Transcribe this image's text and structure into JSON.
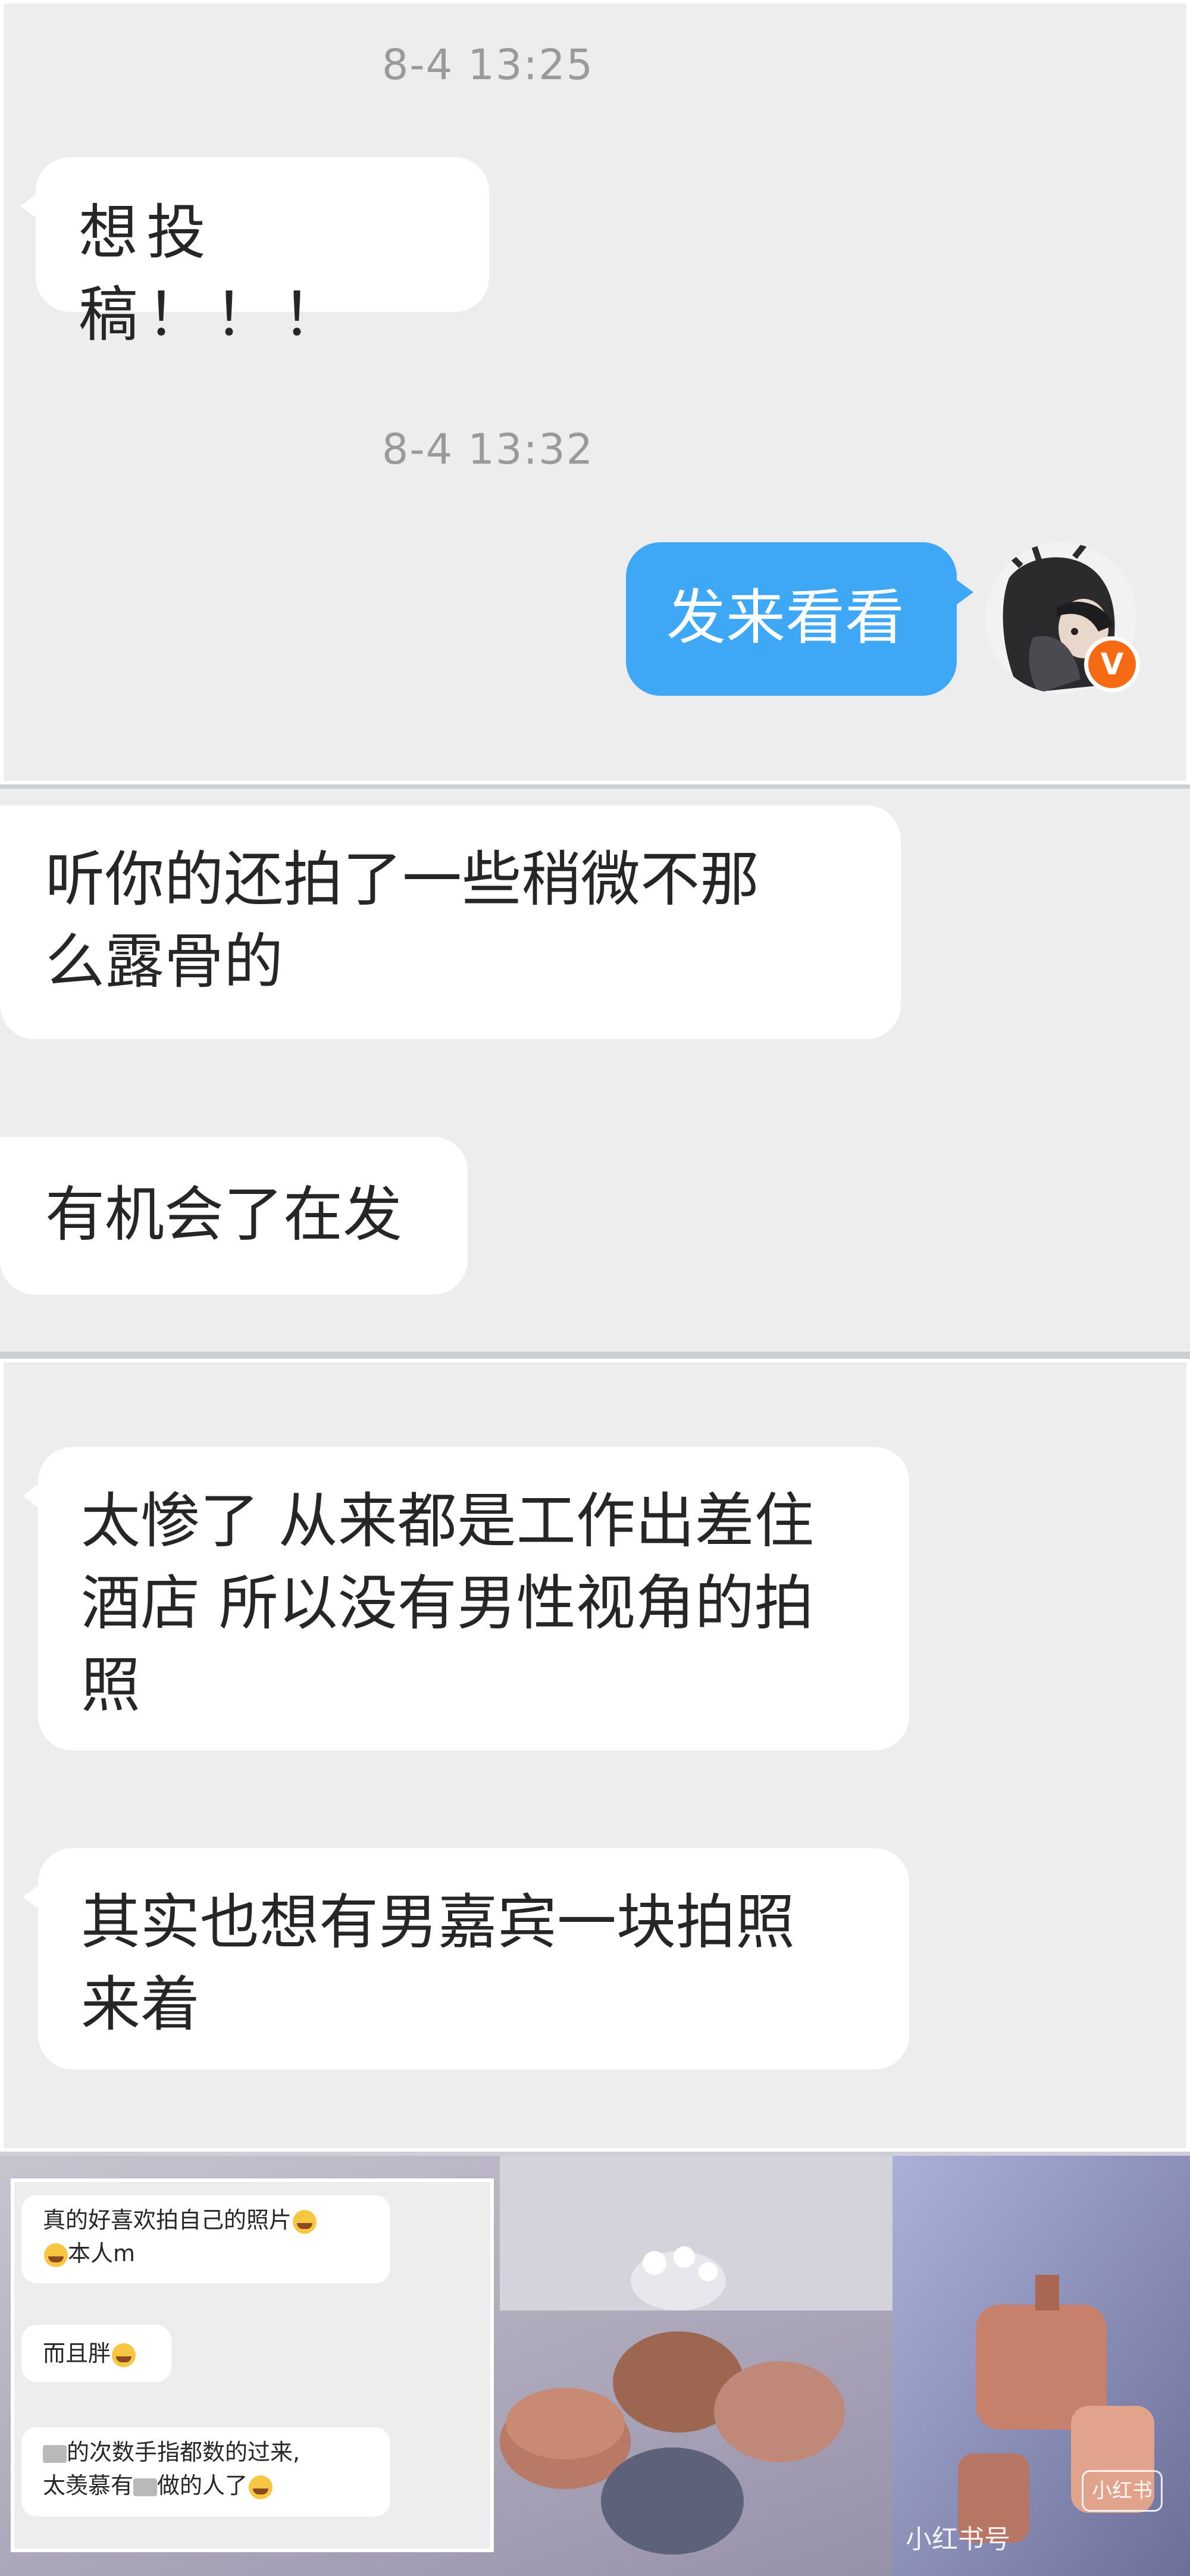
{
  "panel1": {
    "timestamp1": "8-4 13:25",
    "msg1": "想投稿！！！",
    "timestamp2": "8-4 13:32",
    "msg2": "发来看看",
    "avatar_badge": "V"
  },
  "panel2": {
    "msg1_line1": "听你的还拍了一些稍微不那",
    "msg1_line2": "么露骨的",
    "msg2": "有机会了在发"
  },
  "panel3": {
    "msg1_line1": "太惨了 从来都是工作出差住",
    "msg1_line2": "酒店 所以没有男性视角的拍",
    "msg1_line3": "照",
    "msg2_line1": "其实也想有男嘉宾一块拍照",
    "msg2_line2": "来着"
  },
  "panel4": {
    "msg1_line1": "真的好喜欢拍自己的照片",
    "msg1_line2": "本人m",
    "msg2": "而且胖",
    "msg3_line1_part": "的次数手指都数的过来,",
    "msg3_line2_a": "太羡慕有",
    "msg3_line2_b": "做的人了"
  },
  "watermark": {
    "logo": "小红书",
    "id_text": "小红书号"
  },
  "colors": {
    "chat_bg": "#ededed",
    "bubble_white": "#ffffff",
    "bubble_blue": "#3ea7f6",
    "timestamp": "#9a9a9a",
    "badge_orange": "#f56a12"
  },
  "icons": [
    "avatar",
    "verified-badge-icon",
    "crying-emoji-icon",
    "xiaohongshu-logo"
  ]
}
